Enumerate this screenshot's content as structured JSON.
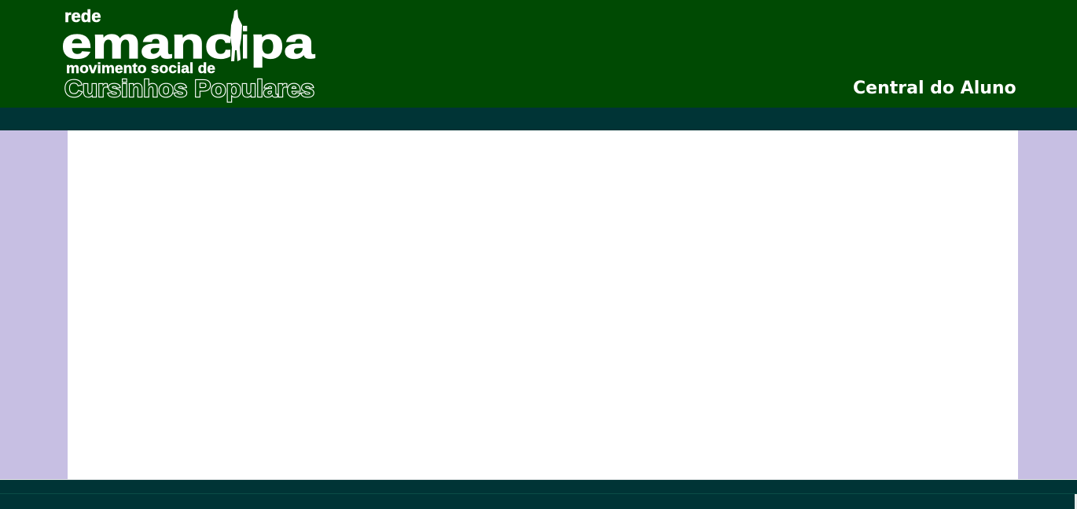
{
  "header": {
    "logo": {
      "line1": "rede",
      "line2": "emancipa",
      "line3": "movimento social de",
      "line4": "Cursinhos Populares"
    },
    "title": "Central do Aluno"
  },
  "colors": {
    "header_bg": "#004a03",
    "nav_bg": "#003436",
    "side_bg": "#c7bfe3",
    "content_bg": "#ffffff",
    "header_text": "#ffffff"
  },
  "icons": {
    "logo": "rede-emancipa-logo"
  }
}
